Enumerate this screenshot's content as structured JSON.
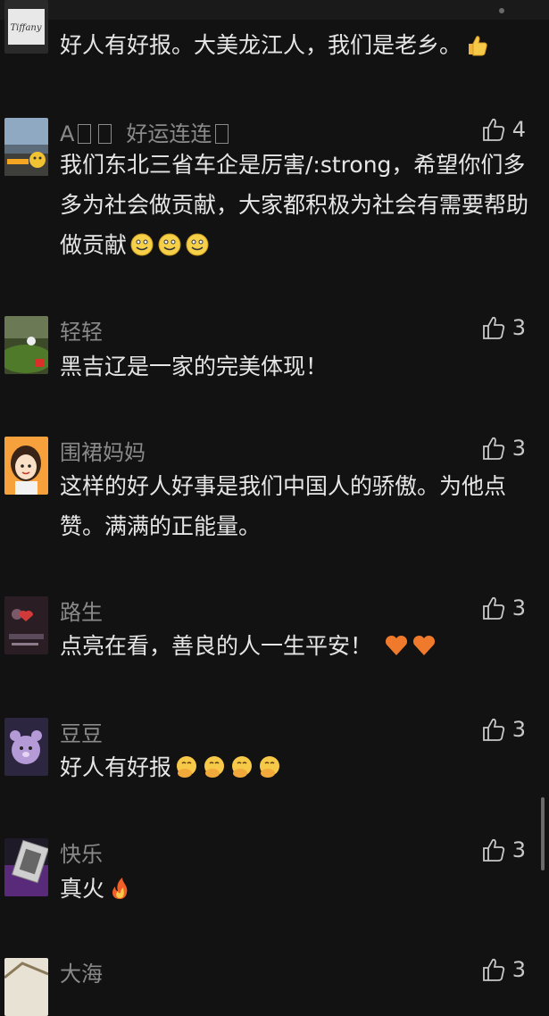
{
  "comments": [
    {
      "name": "",
      "text": "好人有好报。大美龙江人，我们是老乡。",
      "likes": "",
      "avatar_text": "Tiffany"
    },
    {
      "name_prefix": "A",
      "name_suffix": "好运连连",
      "text_line1": "我们东北三省车企是厉害/:strong，希望你们多",
      "text_line2": "多为社会做贡献，大家都积极为社会有需要帮助",
      "text_line3": "做贡献",
      "likes": "4"
    },
    {
      "name": "轻轻",
      "text": "黑吉辽是一家的完美体现！",
      "likes": "3"
    },
    {
      "name": "围裙妈妈",
      "text_line1": "这样的好人好事是我们中国人的骄傲。为他点",
      "text_line2": "赞。满满的正能量。",
      "likes": "3"
    },
    {
      "name": "路生",
      "text": "点亮在看，善良的人一生平安！",
      "likes": "3"
    },
    {
      "name": "豆豆",
      "text": "好人有好报",
      "likes": "3"
    },
    {
      "name": "快乐",
      "text": "真火",
      "likes": "3"
    },
    {
      "name": "大海",
      "likes": "3"
    }
  ],
  "colors": {
    "background": "#121212",
    "name": "#8a8a8a",
    "text": "#e6e6e6",
    "like": "#c8c8c8"
  },
  "icons": {
    "like": "thumbs-up-outline-icon",
    "thumbs_up_emoji": "thumbs-up-emoji",
    "smile_emoji": "smile-emoji",
    "heart_emoji": "orange-heart-emoji",
    "facepalm_emoji": "face-with-hand-over-mouth-emoji",
    "fire_emoji": "fire-emoji"
  }
}
